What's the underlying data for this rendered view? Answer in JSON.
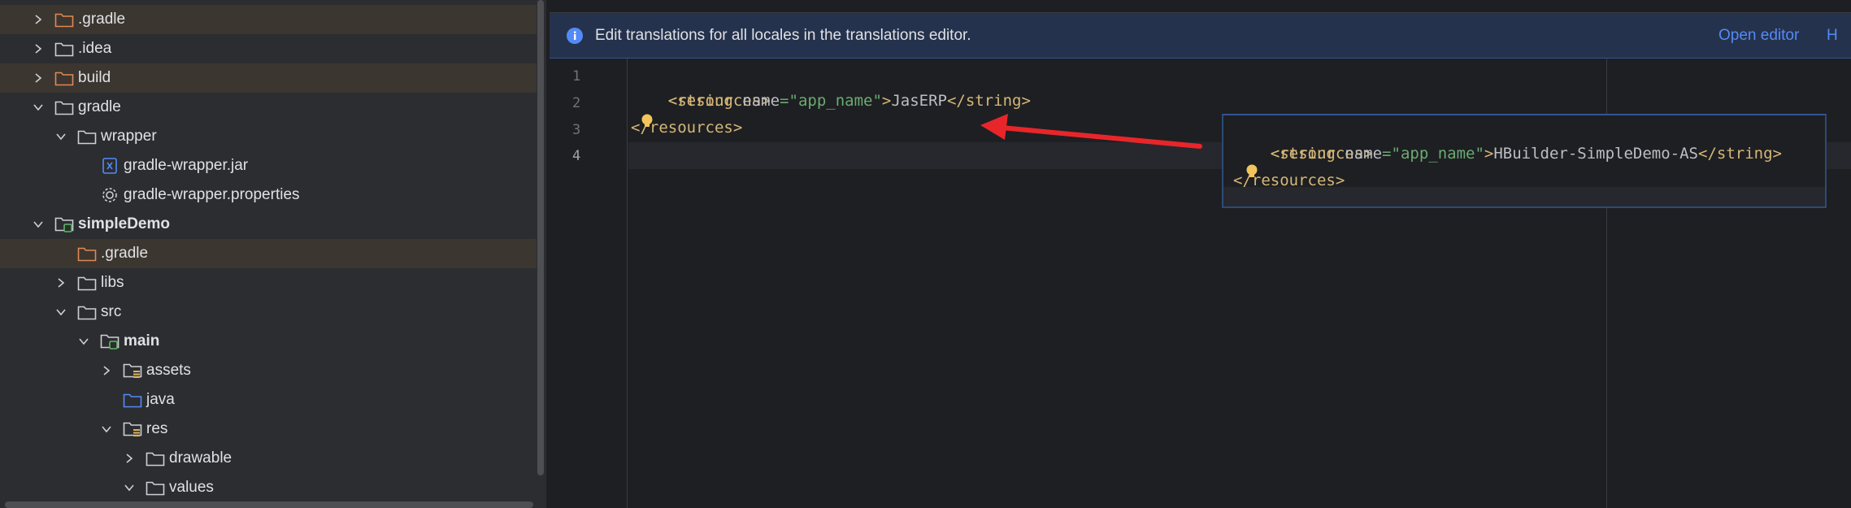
{
  "tree": {
    "items": [
      {
        "label": ".gradle",
        "icon": "folder-icon",
        "chevron": "right",
        "bold": false,
        "excluded": true
      },
      {
        "label": ".idea",
        "icon": "folder-icon",
        "chevron": "right",
        "bold": false,
        "excluded": false
      },
      {
        "label": "build",
        "icon": "folder-icon",
        "chevron": "right",
        "bold": false,
        "excluded": true
      },
      {
        "label": "gradle",
        "icon": "folder-icon",
        "chevron": "down",
        "bold": false,
        "excluded": false
      },
      {
        "label": "wrapper",
        "icon": "folder-icon",
        "chevron": "down",
        "bold": false,
        "excluded": false
      },
      {
        "label": "gradle-wrapper.jar",
        "icon": "archive-file-icon",
        "chevron": "none",
        "bold": false,
        "excluded": false
      },
      {
        "label": "gradle-wrapper.properties",
        "icon": "gear-file-icon",
        "chevron": "none",
        "bold": false,
        "excluded": false
      },
      {
        "label": "simpleDemo",
        "icon": "module-folder-icon",
        "chevron": "down",
        "bold": true,
        "excluded": false
      },
      {
        "label": ".gradle",
        "icon": "folder-icon",
        "chevron": "none",
        "bold": false,
        "excluded": true
      },
      {
        "label": "libs",
        "icon": "folder-icon",
        "chevron": "right",
        "bold": false,
        "excluded": false
      },
      {
        "label": "src",
        "icon": "folder-icon",
        "chevron": "down",
        "bold": false,
        "excluded": false
      },
      {
        "label": "main",
        "icon": "module-folder-icon",
        "chevron": "down",
        "bold": true,
        "excluded": false
      },
      {
        "label": "assets",
        "icon": "resource-folder-icon",
        "chevron": "right",
        "bold": false,
        "excluded": false
      },
      {
        "label": "java",
        "icon": "source-folder-icon",
        "chevron": "none",
        "bold": false,
        "excluded": false
      },
      {
        "label": "res",
        "icon": "resource-folder-icon",
        "chevron": "down",
        "bold": false,
        "excluded": false
      },
      {
        "label": "drawable",
        "icon": "folder-icon",
        "chevron": "right",
        "bold": false,
        "excluded": false
      },
      {
        "label": "values",
        "icon": "folder-icon",
        "chevron": "down",
        "bold": false,
        "excluded": false
      }
    ]
  },
  "banner": {
    "message": "Edit translations for all locales in the translations editor.",
    "open_editor_label": "Open editor",
    "truncated_link": "H"
  },
  "editor": {
    "line_numbers": [
      "1",
      "2",
      "3",
      "4"
    ],
    "line1": {
      "tag": "<resources>"
    },
    "line2": {
      "indent": "    ",
      "open": "<string ",
      "attr": "name",
      "eq": "=",
      "value": "\"app_name\"",
      "close_open": ">",
      "text": "JasERP",
      "end": "</string>"
    },
    "line3": {
      "tag_start": "</",
      "tag_rest": "resources>"
    }
  },
  "snippet": {
    "line1": {
      "tag": "<resources>"
    },
    "line2": {
      "indent": "    ",
      "open": "<string ",
      "attr": "name",
      "eq": "=",
      "value": "\"app_name\"",
      "close_open": ">",
      "text": "HBuilder-SimpleDemo-AS",
      "end": "</string>"
    },
    "line3": {
      "tag_start": "</",
      "tag_rest": "resources>"
    }
  },
  "colors": {
    "arrow": "#e8262a",
    "tag": "#d5b778",
    "string": "#6aab73",
    "link": "#548af7",
    "excluded_bg": "#3c3630"
  }
}
